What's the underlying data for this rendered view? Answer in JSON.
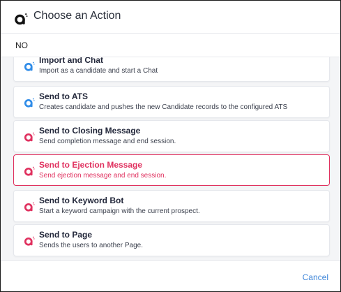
{
  "dialog": {
    "title": "Choose an Action",
    "subtitle": "NO",
    "cancel_label": "Cancel"
  },
  "colors": {
    "blue_icon": "#2f8ce8",
    "pink_icon": "#e0315f",
    "accent": "#e0315f",
    "link": "#3f86d9"
  },
  "actions": [
    {
      "title": "Import and Chat",
      "desc": "Import as a candidate and start a Chat",
      "icon": "blue-logo-icon",
      "selected": false
    },
    {
      "title": "Send to ATS",
      "desc": "Creates candidate and pushes the new Candidate records to the configured ATS",
      "icon": "blue-logo-icon",
      "selected": false
    },
    {
      "title": "Send to Closing Message",
      "desc": "Send completion message and end session.",
      "icon": "pink-logo-icon",
      "selected": false
    },
    {
      "title": "Send to Ejection Message",
      "desc": "Send ejection message and end session.",
      "icon": "pink-logo-icon",
      "selected": true
    },
    {
      "title": "Send to Keyword Bot",
      "desc": "Start a keyword campaign with the current prospect.",
      "icon": "pink-logo-icon",
      "selected": false
    },
    {
      "title": "Send to Page",
      "desc": "Sends the users to another Page.",
      "icon": "pink-logo-icon",
      "selected": false
    }
  ]
}
